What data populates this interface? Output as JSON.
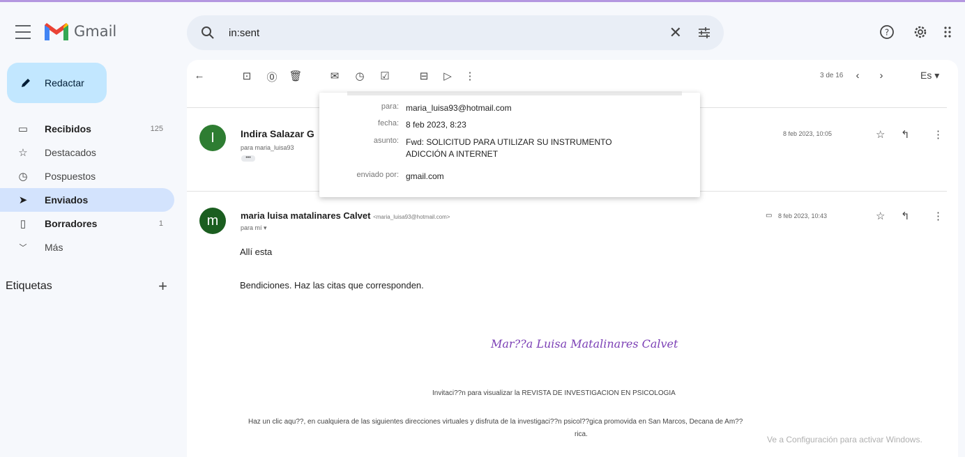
{
  "app": {
    "name": "Gmail"
  },
  "search": {
    "query": "in:sent"
  },
  "sidebar": {
    "compose_label": "Redactar",
    "items": [
      {
        "label": "Recibidos",
        "count": "125"
      },
      {
        "label": "Destacados",
        "count": ""
      },
      {
        "label": "Pospuestos",
        "count": ""
      },
      {
        "label": "Enviados",
        "count": ""
      },
      {
        "label": "Borradores",
        "count": "1"
      },
      {
        "label": "Más",
        "count": ""
      }
    ],
    "labels_title": "Etiquetas",
    "labels_add": "+"
  },
  "toolbar": {
    "pager": "3 de 16",
    "language": "Es"
  },
  "thread": {
    "message1": {
      "avatar_letter": "I",
      "sender": "Indira Salazar G",
      "to": "para maria_luisa93",
      "dots": "•••",
      "date": "8 feb 2023, 10:05"
    },
    "message2": {
      "avatar_letter": "m",
      "sender": "maria luisa matalinares Calvet",
      "email": "<maria_luisa93@hotmail.com>",
      "to": "para mí",
      "date": "8 feb 2023, 10:43",
      "body_line1": "Allí esta",
      "body_line2": "Bendiciones. Haz las citas que corresponden.",
      "signature": "Mar??a Luisa Matalinares Calvet",
      "invite": "Invitaci??n para visualizar la REVISTA DE INVESTIGACION EN PSICOLOGIA",
      "click_line1": "Haz un clic aqu??,  en cualquiera de las siguientes direcciones virtuales y disfruta de la investigaci??n psicol??gica promovida en San Marcos, Decana de Am??",
      "click_line2": "rica."
    }
  },
  "popup": {
    "rows": [
      {
        "key": "para:",
        "value": "maria_luisa93@hotmail.com"
      },
      {
        "key": "fecha:",
        "value": "8 feb 2023, 8:23"
      },
      {
        "key": "asunto:",
        "value": "Fwd: SOLICITUD PARA UTILIZAR SU INSTRUMENTO ADICCIÓN A INTERNET"
      },
      {
        "key": "enviado por:",
        "value": "gmail.com"
      }
    ]
  },
  "watermark": "Ve a Configuración para activar Windows.",
  "colors": {
    "compose_bg": "#c2e7ff",
    "active_nav": "#d3e3fd",
    "avatar1": "#2e7d32",
    "avatar2": "#1b5e20",
    "signature": "#7b3fb5"
  }
}
